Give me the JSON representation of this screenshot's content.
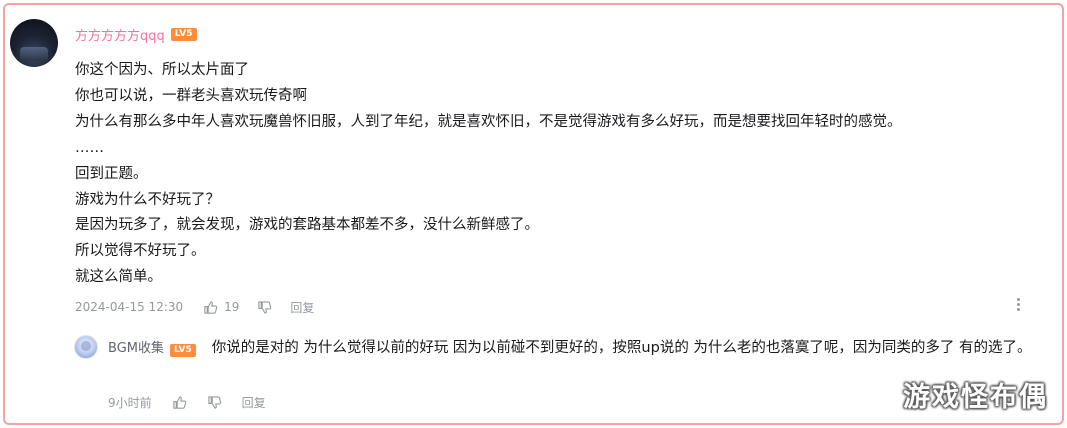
{
  "comment": {
    "username": "方方方方方qqq",
    "level_badge": "LV5",
    "lines": [
      "你这个因为、所以太片面了",
      "你也可以说，一群老头喜欢玩传奇啊",
      "为什么有那么多中年人喜欢玩魔兽怀旧服，人到了年纪，就是喜欢怀旧，不是觉得游戏有多么好玩，而是想要找回年轻时的感觉。",
      "……",
      "回到正题。",
      "游戏为什么不好玩了？",
      "是因为玩多了，就会发现，游戏的套路基本都差不多，没什么新鲜感了。",
      "所以觉得不好玩了。",
      "就这么简单。"
    ],
    "timestamp": "2024-04-15 12:30",
    "like_count": "19",
    "reply_label": "回复"
  },
  "reply": {
    "username": "BGM收集",
    "level_badge": "LV5",
    "text": "你说的是对的 为什么觉得以前的好玩 因为以前碰不到更好的，按照up说的 为什么老的也落寞了呢，因为同类的多了 有的选了。",
    "timestamp": "9小时前",
    "reply_label": "回复"
  },
  "watermark": "游戏怪布偶",
  "icons": {
    "like": "thumbs-up-icon",
    "dislike": "thumbs-down-icon",
    "more": "more-vertical-icon"
  },
  "colors": {
    "username": "#fb7299",
    "level_badge": "#ff8c3b",
    "meta_text": "#9499a0",
    "border": "#f3a3a3"
  }
}
